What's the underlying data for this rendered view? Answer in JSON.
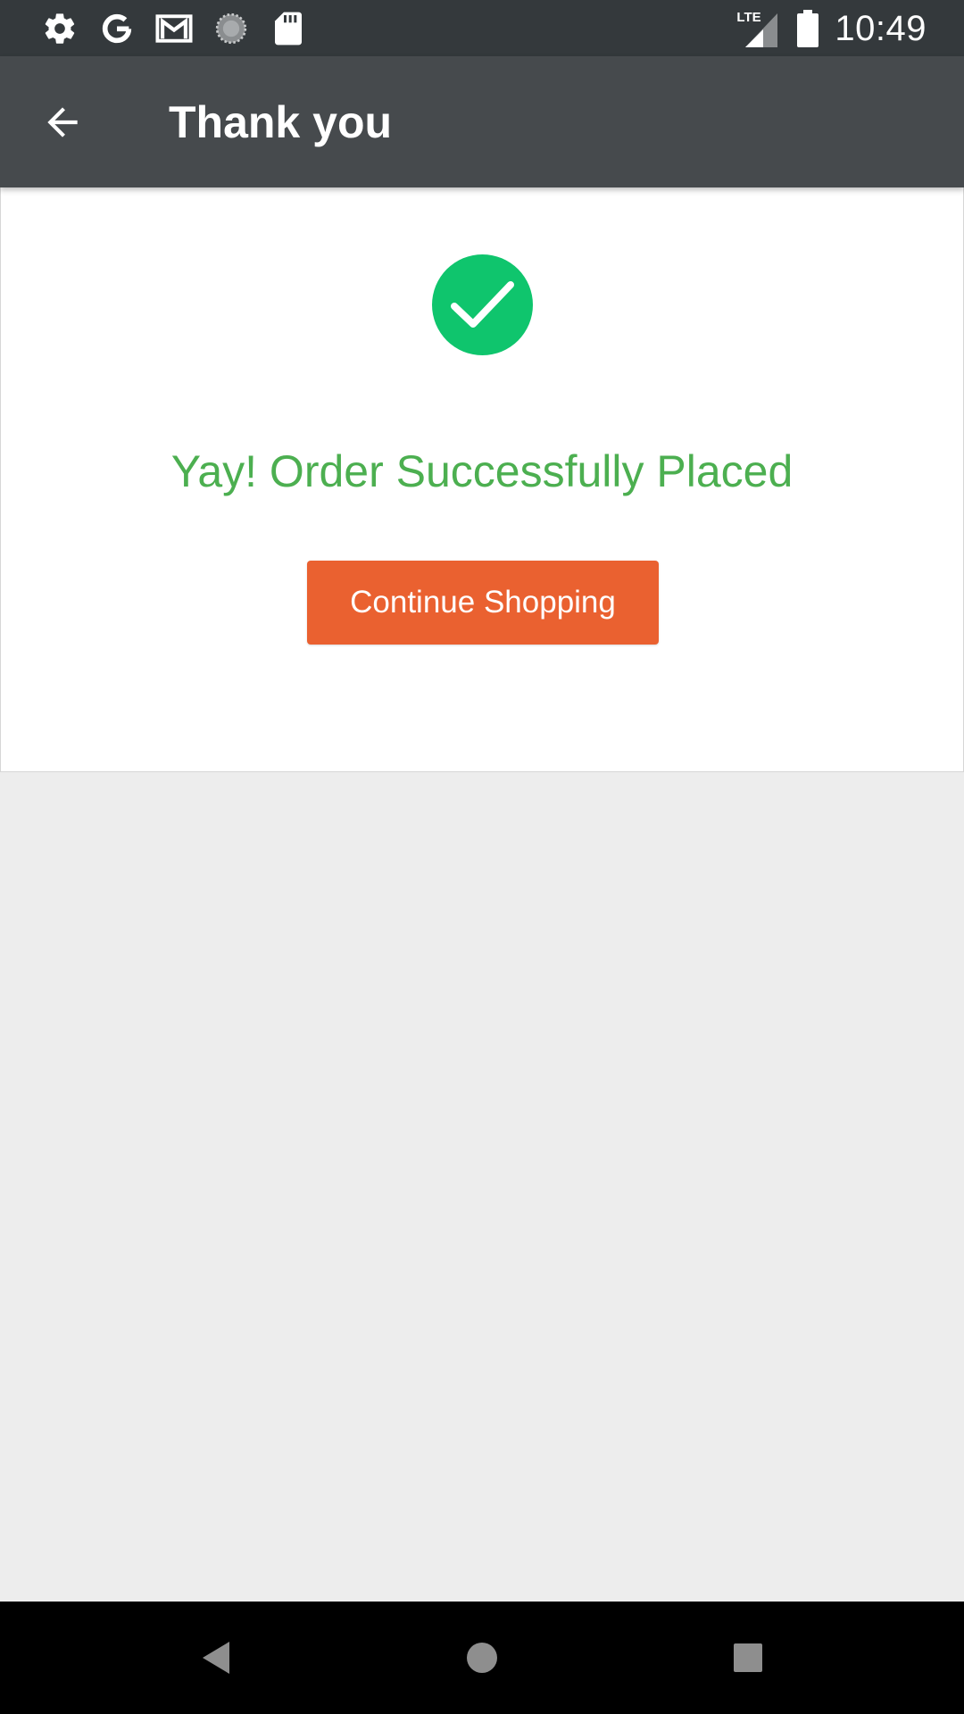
{
  "status_bar": {
    "time": "10:49",
    "network_label": "LTE",
    "icons": [
      "settings-icon",
      "google-icon",
      "gmail-icon",
      "sync-icon",
      "sd-card-icon",
      "lte-signal-icon",
      "battery-icon"
    ]
  },
  "app_bar": {
    "title": "Thank you",
    "back_icon": "arrow-back-icon"
  },
  "content": {
    "success_icon": "check-circle-icon",
    "message": "Yay! Order Successfully Placed",
    "button_label": "Continue Shopping"
  },
  "nav_bar": {
    "icons": [
      "back-triangle-icon",
      "home-circle-icon",
      "recents-square-icon"
    ]
  },
  "colors": {
    "status_bar_bg": "#34393c",
    "app_bar_bg": "#464a4d",
    "success_green": "#0fc56d",
    "message_green": "#4caf50",
    "button_orange": "#ea6130",
    "page_bg": "#ededed"
  }
}
